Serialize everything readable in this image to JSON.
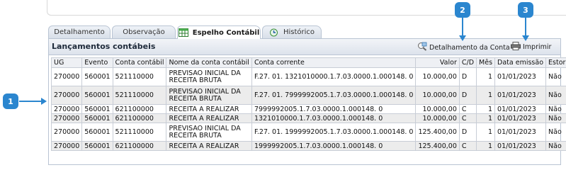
{
  "tabs": [
    {
      "label": "Detalhamento"
    },
    {
      "label": "Observação"
    },
    {
      "label": "Espelho Contábil"
    },
    {
      "label": "Histórico"
    }
  ],
  "panel": {
    "title": "Lançamentos contábeis",
    "detail_button": "Detalhamento da Conta",
    "print_button": "Imprimir"
  },
  "table": {
    "columns": [
      "UG",
      "Evento",
      "Conta contábil",
      "Nome da conta contábil",
      "Conta corrente",
      "Valor",
      "C/D",
      "Mês",
      "Data emissão",
      "Estorno"
    ],
    "rows": [
      [
        "270000",
        "560001",
        "521110000",
        "PREVISAO INICIAL DA RECEITA BRUTA",
        "F.27. 01. 1321010000.1.7.03.0000.1.000148. 0",
        "10.000,00",
        "D",
        "1",
        "01/01/2023",
        "Não"
      ],
      [
        "270000",
        "560001",
        "521110000",
        "PREVISAO INICIAL DA RECEITA BRUTA",
        "F.27. 01. 7999992005.1.7.03.0000.1.000148. 0",
        "10.000,00",
        "D",
        "1",
        "01/01/2023",
        "Não"
      ],
      [
        "270000",
        "560001",
        "621100000",
        "RECEITA A REALIZAR",
        "7999992005.1.7.03.0000.1.000148. 0",
        "10.000,00",
        "C",
        "1",
        "01/01/2023",
        "Não"
      ],
      [
        "270000",
        "560001",
        "621100000",
        "RECEITA A REALIZAR",
        "1321010000.1.7.03.0000.1.000148. 0",
        "10.000,00",
        "C",
        "1",
        "01/01/2023",
        "Não"
      ],
      [
        "270000",
        "560001",
        "521110000",
        "PREVISAO INICIAL DA RECEITA BRUTA",
        "F.27. 01. 1999992005.1.7.03.0000.1.000148. 0",
        "125.400,00",
        "D",
        "1",
        "01/01/2023",
        "Não"
      ],
      [
        "270000",
        "560001",
        "621100000",
        "RECEITA A REALIZAR",
        "1999992005.1.7.03.0000.1.000148. 0",
        "125.400,00",
        "C",
        "1",
        "01/01/2023",
        "Não"
      ]
    ]
  },
  "callouts": [
    "1",
    "2",
    "3"
  ],
  "colors": {
    "callout": "#2b86cf",
    "header_bg": "#dde3ec",
    "border": "#b9c4d3"
  }
}
